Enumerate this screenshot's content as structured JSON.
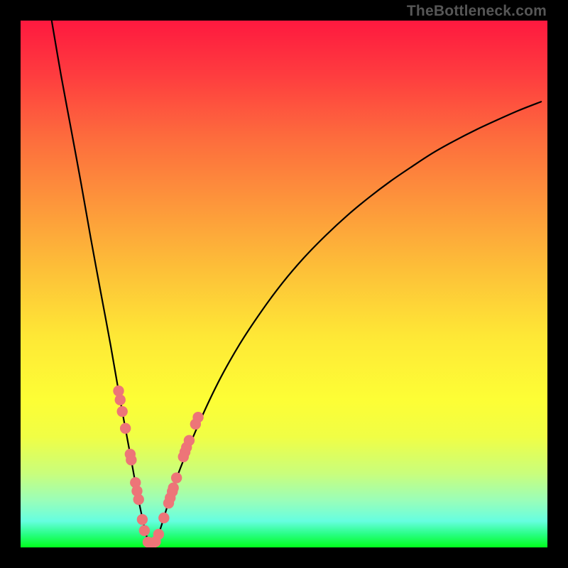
{
  "watermark": "TheBottleneck.com",
  "colors": {
    "frame": "#000000",
    "curve": "#000000",
    "marker_fill": "#ED7578",
    "marker_stroke": "#ED7578"
  },
  "gradient_stops": [
    {
      "offset": 0.0,
      "color": "#FE193F"
    },
    {
      "offset": 0.1,
      "color": "#FE3B3F"
    },
    {
      "offset": 0.22,
      "color": "#FD6B3D"
    },
    {
      "offset": 0.35,
      "color": "#FD973B"
    },
    {
      "offset": 0.48,
      "color": "#FDC238"
    },
    {
      "offset": 0.6,
      "color": "#FEE836"
    },
    {
      "offset": 0.72,
      "color": "#FDFE35"
    },
    {
      "offset": 0.79,
      "color": "#F0FE45"
    },
    {
      "offset": 0.86,
      "color": "#C9FE7C"
    },
    {
      "offset": 0.91,
      "color": "#9BFEB8"
    },
    {
      "offset": 0.95,
      "color": "#66FEE0"
    },
    {
      "offset": 0.975,
      "color": "#28FE84"
    },
    {
      "offset": 1.0,
      "color": "#02FE1D"
    }
  ],
  "chart_data": {
    "type": "line",
    "title": "",
    "xlabel": "",
    "ylabel": "",
    "xlim": [
      0,
      100
    ],
    "ylim": [
      0,
      100
    ],
    "series": [
      {
        "name": "bottleneck-curve",
        "x": [
          5.9,
          7.7,
          9.6,
          11.5,
          13.3,
          15.2,
          17.1,
          18.9,
          20.8,
          22.7,
          24.5,
          26.0,
          29.3,
          33.4,
          37.5,
          41.6,
          45.7,
          49.7,
          53.8,
          57.9,
          62.0,
          66.1,
          70.2,
          74.3,
          78.3,
          82.4,
          86.5,
          90.6,
          94.7,
          98.8
        ],
        "y": [
          100.0,
          89.5,
          79.3,
          69.0,
          58.8,
          48.5,
          38.3,
          28.0,
          17.7,
          7.5,
          0.5,
          2.0,
          12.3,
          22.5,
          31.3,
          38.6,
          44.8,
          50.2,
          55.0,
          59.2,
          63.0,
          66.4,
          69.5,
          72.3,
          74.9,
          77.2,
          79.3,
          81.2,
          83.0,
          84.6
        ]
      }
    ],
    "markers": {
      "name": "highlighted-points",
      "points": [
        {
          "x": 18.6,
          "y": 29.7
        },
        {
          "x": 18.9,
          "y": 28.0
        },
        {
          "x": 19.3,
          "y": 25.8
        },
        {
          "x": 19.9,
          "y": 22.6
        },
        {
          "x": 20.8,
          "y": 17.7
        },
        {
          "x": 21.0,
          "y": 16.6
        },
        {
          "x": 21.8,
          "y": 12.3
        },
        {
          "x": 22.1,
          "y": 10.7
        },
        {
          "x": 22.4,
          "y": 9.1
        },
        {
          "x": 23.1,
          "y": 5.3
        },
        {
          "x": 23.5,
          "y": 3.2
        },
        {
          "x": 24.2,
          "y": 1.0
        },
        {
          "x": 24.8,
          "y": 0.4
        },
        {
          "x": 25.6,
          "y": 1.1
        },
        {
          "x": 26.2,
          "y": 2.5
        },
        {
          "x": 27.2,
          "y": 5.6
        },
        {
          "x": 28.1,
          "y": 8.4
        },
        {
          "x": 28.4,
          "y": 9.4
        },
        {
          "x": 28.8,
          "y": 10.6
        },
        {
          "x": 29.0,
          "y": 11.3
        },
        {
          "x": 29.6,
          "y": 13.2
        },
        {
          "x": 30.9,
          "y": 17.2
        },
        {
          "x": 31.2,
          "y": 18.1
        },
        {
          "x": 31.5,
          "y": 19.0
        },
        {
          "x": 32.0,
          "y": 20.3
        },
        {
          "x": 33.2,
          "y": 23.4
        },
        {
          "x": 33.7,
          "y": 24.7
        }
      ]
    }
  }
}
